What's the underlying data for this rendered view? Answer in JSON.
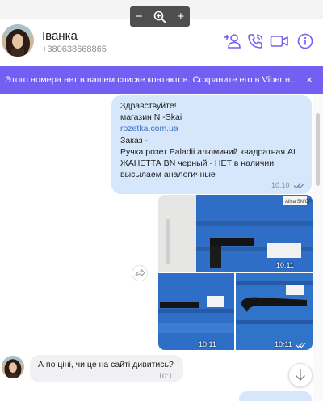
{
  "zoom": {
    "minus": "−",
    "plus": "+"
  },
  "contact": {
    "name": "Іванка",
    "phone": "+380638668865"
  },
  "header_icons": [
    "add-contact-icon",
    "phone-icon",
    "video-call-icon",
    "info-icon"
  ],
  "banner": {
    "text": "Этого номера нет в вашем списке контактов. Сохраните его в Viber н...",
    "close": "×"
  },
  "messages": {
    "outgoing": {
      "lines": [
        "Здравствуйте!",
        "магазин  N -Skai",
        "rozetka.com.ua",
        "Заказ -",
        "Ручка розет Paladii алюминий квадратная AL",
        "ЖАНЕТТА BN черный - НЕТ в наличии",
        "высылаем аналогичные"
      ],
      "time": "10:10"
    },
    "photos": {
      "times": [
        "10:11",
        "10:11",
        "10:11"
      ],
      "label": "Alisa SN/CP"
    },
    "incoming": {
      "text": "А по ціні, чи це на сайті дивитись?",
      "time": "10:11"
    }
  },
  "colors": {
    "accent": "#7360f2",
    "outgoing_bubble": "#d6e7fb",
    "incoming_bubble": "#f1f1f3",
    "link": "#3d6fc9"
  }
}
